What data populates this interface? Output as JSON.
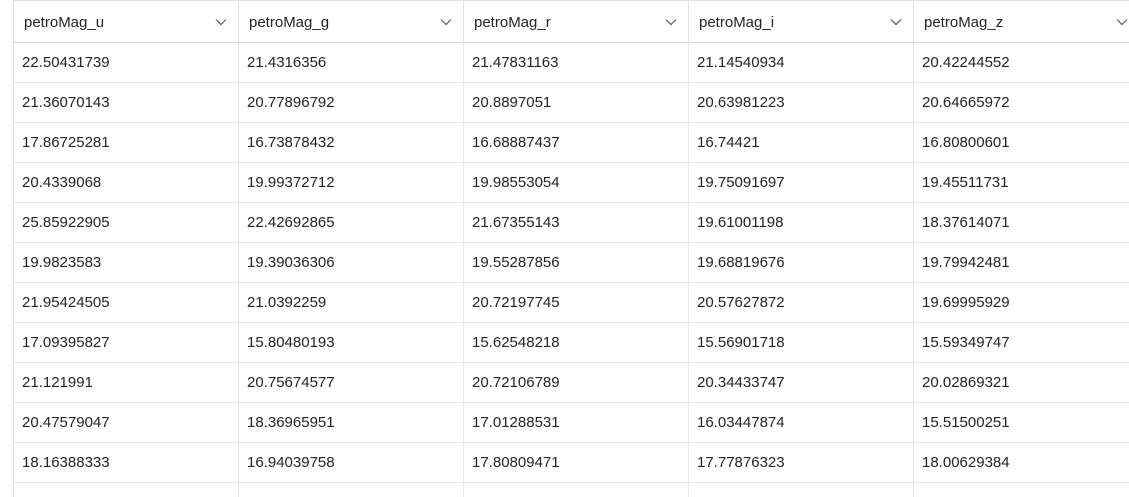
{
  "columns": [
    {
      "label": "petroMag_u",
      "icon": "chevron-down-icon"
    },
    {
      "label": "petroMag_g",
      "icon": "chevron-down-icon"
    },
    {
      "label": "petroMag_r",
      "icon": "chevron-down-icon"
    },
    {
      "label": "petroMag_i",
      "icon": "chevron-down-icon"
    },
    {
      "label": "petroMag_z",
      "icon": "chevron-down-icon"
    }
  ],
  "rows": [
    [
      "22.50431739",
      "21.4316356",
      "21.47831163",
      "21.14540934",
      "20.42244552"
    ],
    [
      "21.36070143",
      "20.77896792",
      "20.8897051",
      "20.63981223",
      "20.64665972"
    ],
    [
      "17.86725281",
      "16.73878432",
      "16.68887437",
      "16.74421",
      "16.80800601"
    ],
    [
      "20.4339068",
      "19.99372712",
      "19.98553054",
      "19.75091697",
      "19.45511731"
    ],
    [
      "25.85922905",
      "22.42692865",
      "21.67355143",
      "19.61001198",
      "18.37614071"
    ],
    [
      "19.9823583",
      "19.39036306",
      "19.55287856",
      "19.68819676",
      "19.79942481"
    ],
    [
      "21.95424505",
      "21.0392259",
      "20.72197745",
      "20.57627872",
      "19.69995929"
    ],
    [
      "17.09395827",
      "15.80480193",
      "15.62548218",
      "15.56901718",
      "15.59349747"
    ],
    [
      "21.121991",
      "20.75674577",
      "20.72106789",
      "20.34433747",
      "20.02869321"
    ],
    [
      "20.47579047",
      "18.36965951",
      "17.01288531",
      "16.03447874",
      "15.51500251"
    ],
    [
      "18.16388333",
      "16.94039758",
      "17.80809471",
      "17.77876323",
      "18.00629384"
    ]
  ],
  "colors": {
    "grid_line": "#e6e6e6",
    "header_border": "#d6d6d6",
    "text": "#242424",
    "background": "#ffffff"
  }
}
